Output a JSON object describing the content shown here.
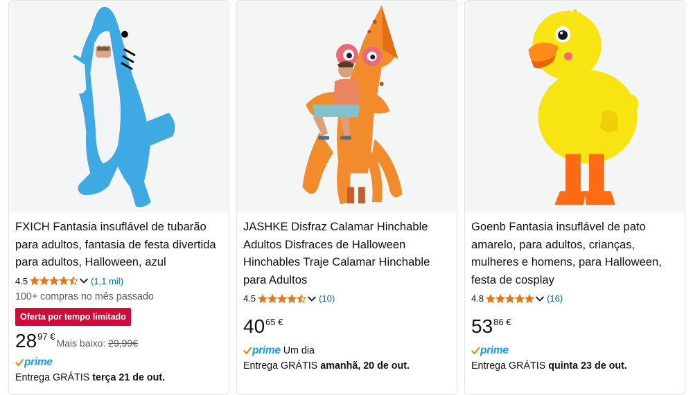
{
  "products": [
    {
      "title": "FXICH Fantasia insuflável de tubarão para adultos, fantasia de festa divertida para adultos, Halloween, azul",
      "rating": "4.5",
      "stars": 4.5,
      "rating_count": "(1,1 mil)",
      "bought": "100+ compras no mês passado",
      "badge": "Oferta por tempo limitado",
      "price_whole": "28",
      "price_fraction": "97 €",
      "was_label": "Mais baixo: ",
      "was_price": "29,99€",
      "prime": "prime",
      "prime_extra": "",
      "delivery_prefix": "Entrega GRÁTIS ",
      "delivery_date": "terça 21 de out.",
      "image_icon": "shark-costume-image"
    },
    {
      "title": "JASHKE Disfraz Calamar Hinchable Adultos Disfraces de Halloween Hinchables Traje Calamar Hinchable para Adultos",
      "rating": "4.5",
      "stars": 4.5,
      "rating_count": "(10)",
      "price_whole": "40",
      "price_fraction": "65 €",
      "prime": "prime",
      "prime_extra": "Um dia",
      "delivery_prefix": "Entrega GRÁTIS ",
      "delivery_date": "amanhã, 20 de out.",
      "image_icon": "squid-costume-image"
    },
    {
      "title": "Goenb Fantasia insuflável de pato amarelo, para adultos, crianças, mulheres e homens, para Halloween, festa de cosplay",
      "rating": "4.8",
      "stars": 5,
      "rating_count": "(16)",
      "price_whole": "53",
      "price_fraction": "86 €",
      "prime": "prime",
      "prime_extra": "",
      "delivery_prefix": "Entrega GRÁTIS ",
      "delivery_date": "quinta 23 de out.",
      "image_icon": "duck-costume-image"
    }
  ],
  "colors": {
    "star": "#de7921",
    "link": "#007185",
    "badge_bg": "#cc0c39",
    "prime_blue": "#1399ff",
    "prime_check": "#f08804"
  }
}
